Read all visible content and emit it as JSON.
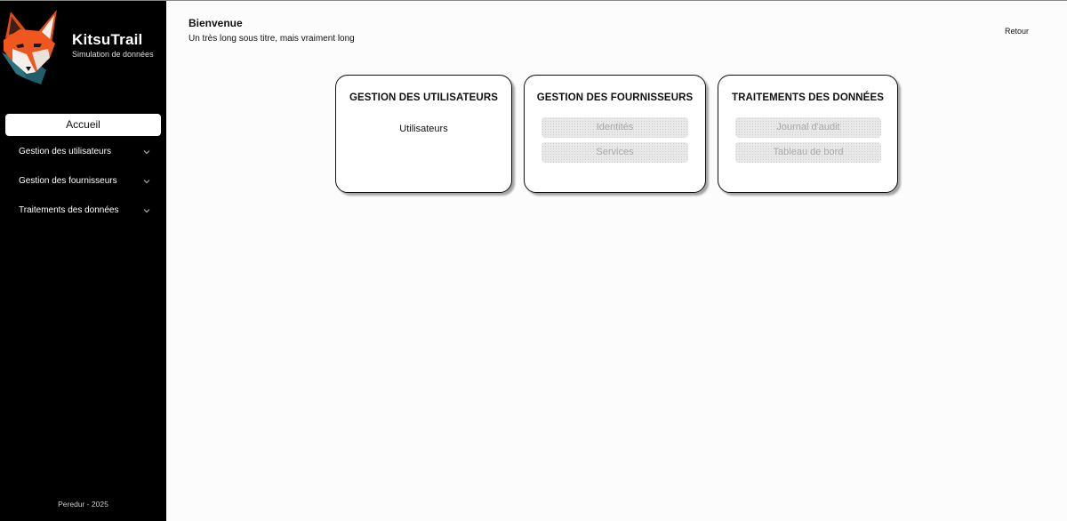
{
  "brand": {
    "name": "KitsuTrail",
    "subtitle": "Simulation de données"
  },
  "nav": {
    "home": "Accueil",
    "items": [
      {
        "label": "Gestion des utilisateurs"
      },
      {
        "label": "Gestion des fournisseurs"
      },
      {
        "label": "Traitements des données"
      }
    ]
  },
  "footer": "Peredur - 2025",
  "header": {
    "title": "Bienvenue",
    "subtitle": "Un très long sous titre, mais vraiment long",
    "back": "Retour"
  },
  "cards": [
    {
      "title": "GESTION DES UTILISATEURS",
      "links": [
        "Utilisateurs"
      ]
    },
    {
      "title": "GESTION DES FOURNISSEURS",
      "disabled": [
        "Identités",
        "Services"
      ]
    },
    {
      "title": "TRAITEMENTS DES DONNÉES",
      "disabled": [
        "Journal d'audit",
        "Tableau de bord"
      ]
    }
  ],
  "colors": {
    "sidebar_bg": "#000000",
    "fox_orange": "#f0571f",
    "fox_teal": "#1f5f6b",
    "disabled_text": "#a9a9a9"
  },
  "icons": {
    "logo": "fox-logo-icon",
    "expand": "chevron-down-icon"
  }
}
